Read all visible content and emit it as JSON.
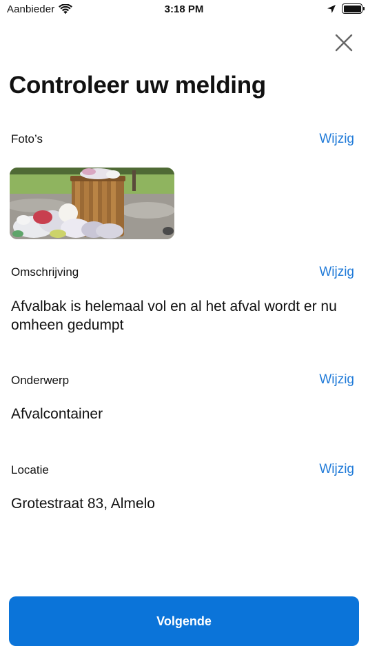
{
  "status_bar": {
    "carrier": "Aanbieder",
    "time": "3:18 PM",
    "icons": [
      "wifi-icon",
      "location-arrow-icon",
      "battery-icon"
    ]
  },
  "header": {
    "close_icon": "close-icon",
    "title": "Controleer uw melding"
  },
  "sections": {
    "photos": {
      "label": "Foto’s",
      "edit_label": "Wijzig"
    },
    "description": {
      "label": "Omschrijving",
      "edit_label": "Wijzig",
      "value": "Afvalbak is helemaal vol en al het afval wordt er nu omheen gedumpt"
    },
    "subject": {
      "label": "Onderwerp",
      "edit_label": "Wijzig",
      "value": "Afvalcontainer"
    },
    "location": {
      "label": "Locatie",
      "edit_label": "Wijzig",
      "value": "Grotestraat 83, Almelo"
    }
  },
  "footer": {
    "next_label": "Volgende"
  },
  "colors": {
    "accent": "#0b74d9",
    "link": "#1f7ad8",
    "text": "#111111",
    "background": "#ffffff"
  }
}
